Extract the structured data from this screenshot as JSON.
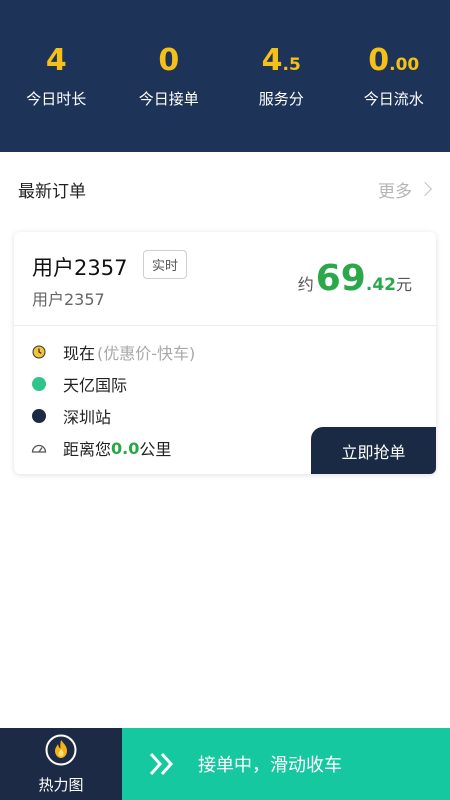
{
  "stats": [
    {
      "value": "4",
      "frac": "",
      "label": "今日时长"
    },
    {
      "value": "0",
      "frac": "",
      "label": "今日接单"
    },
    {
      "value": "4",
      "frac": ".5",
      "label": "服务分"
    },
    {
      "value": "0",
      "frac": ".00",
      "label": "今日流水"
    }
  ],
  "section": {
    "title": "最新订单",
    "more": "更多"
  },
  "order": {
    "name": "用户2357",
    "tag": "实时",
    "sub": "用户2357",
    "price_prefix": "约",
    "price_int": "69",
    "price_dec": ".42",
    "price_unit": "元",
    "time": "现在",
    "time_note": "(优惠价-快车)",
    "origin": "天亿国际",
    "destination": "深圳站",
    "distance_prefix": "距离您",
    "distance_value": "0.0",
    "distance_unit": "公里",
    "grab_label": "立即抢单"
  },
  "bottom": {
    "heat_label": "热力图",
    "slide_label": "接单中，滑动收车"
  },
  "colors": {
    "header_bg": "#1e3358",
    "stat_accent": "#f5c118",
    "price_green": "#2aa84a",
    "slide_bg": "#15c8a0",
    "navy": "#1c2a45"
  },
  "icons": {
    "time": "clock-icon",
    "origin": "green-dot-icon",
    "destination": "navy-dot-icon",
    "distance": "speedometer-icon",
    "heat": "flame-icon",
    "slide": "double-chevron-icon",
    "more": "chevron-right-icon"
  }
}
